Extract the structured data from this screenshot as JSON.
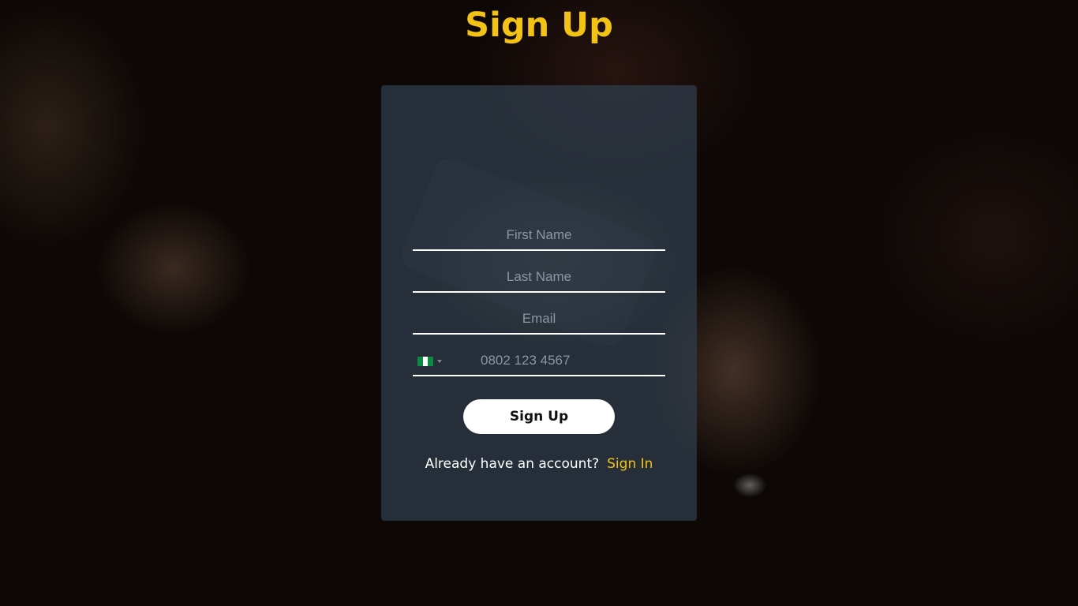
{
  "form": {
    "title": "Sign Up",
    "first_name_placeholder": "First Name",
    "last_name_placeholder": "Last Name",
    "email_placeholder": "Email",
    "phone_placeholder": "0802 123 4567",
    "country_flag": "nigeria-flag-icon",
    "submit_label": "Sign Up",
    "signin_prompt": "Already have an account?",
    "signin_link": "Sign In"
  },
  "colors": {
    "accent": "#f2c314",
    "card": "#303e4e",
    "button": "#ffffff"
  }
}
